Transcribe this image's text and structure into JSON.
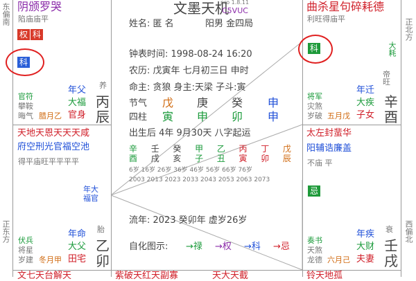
{
  "app": {
    "title": "文墨天机",
    "sub": "C5VUC",
    "ver": "pro 1.8.11"
  },
  "chart_main": {
    "name": "姓名: 匿 名",
    "gender": "阳男 金四局",
    "clock": "钟表时间: 1998-08-24 16:20",
    "lunar": "农历: 戊寅年 七月初三日 申时",
    "ming": "命主: 贪狼 身主:天梁 子斗:寅",
    "jieqi_label": "节气",
    "sizhu_label": "四柱",
    "jieqi": [
      "戊",
      "庚",
      "癸",
      "申"
    ],
    "sizhu": [
      "寅",
      "申",
      "卯",
      "申"
    ],
    "qiyun": "出生后 4年 9月30天 八字起运",
    "liunian": "流年: 2023 癸卯年 虚岁26岁",
    "zihua_label": "自化图示:",
    "zihua": [
      "→禄",
      "→权",
      "→科",
      "→忌"
    ],
    "dayun_stems": [
      "辛酉",
      "壬戌",
      "癸亥",
      "甲子",
      "乙丑",
      "丙寅",
      "丁卯",
      "戊辰"
    ],
    "dayun_ages": "6岁 16岁 26岁 36岁 46岁 56岁 66岁 76岁",
    "dayun_years": "2003 2013 2023 2033 2043 2053 2063 2073"
  },
  "cell_top_left": {
    "stars": "阴颁罗哭",
    "brightness": "陷庙庙平",
    "badge1": "权",
    "badge2": "科",
    "badge3": "科",
    "side": "东偏南"
  },
  "cell_mid_left": {
    "changsheng": "养",
    "shen1": "官符",
    "shen2": "攀鞍",
    "shen3": "晦气",
    "yun1": "年父",
    "yun2": "大福",
    "flow": "腊月乙",
    "palace": "官身",
    "ganzhi": "丙辰"
  },
  "cell_row2_left": {
    "stars_top": "天地天恩天天天咸",
    "stars_bot": "府空刑光官福空池",
    "brightness": "得平庙旺平平平平"
  },
  "cell_bottom_left": {
    "changsheng": "胎",
    "shen1": "伏兵",
    "shen2": "将星",
    "shen3": "岁建",
    "yun1": "年命",
    "yun2": "大父",
    "flow": "冬月甲",
    "palace": "田宅",
    "ganzhi": "乙卯",
    "side": "正东方"
  },
  "cell_top_right": {
    "stars": "曲杀星句碎耗德",
    "brightness": "利旺得庙平",
    "badge": "科",
    "side": "正北方"
  },
  "cell_mid_right": {
    "changsheng": "帝旺",
    "big": "大耗",
    "shen1": "将军",
    "shen2": "灾煞",
    "shen3": "岁破",
    "yun1": "年迁",
    "yun2": "大疾",
    "flow": "五月戊",
    "palace": "子女",
    "ganzhi": "辛酉"
  },
  "cell_row2_right": {
    "stars_top": "太左封蜚华",
    "stars_bot": "阳辅诰廉盖",
    "brightness": "不庙 平",
    "badge": "忌"
  },
  "cell_bottom_right": {
    "changsheng": "衰",
    "shen1": "奏书",
    "shen2": "天煞",
    "shen3": "龙德",
    "yun1": "年疾",
    "yun2": "大财",
    "flow": "六月己",
    "palace": "夫妻",
    "ganzhi": "壬戌",
    "side": "西偏北"
  },
  "left_mid_tag": {
    "a": "年大",
    "b": "福官"
  },
  "bottom_strip": {
    "left": "文七天台解天",
    "mid1": "紫破天红天副寡",
    "mid2": "天大天截",
    "right": "铃天地孤"
  },
  "colors": {
    "red": "#d0202a",
    "blue": "#1f4fd8",
    "green": "#1a9a3a",
    "badge_red": "#d83a2a",
    "badge_blue": "#2a5fd8",
    "badge_green": "#1e9a3a"
  }
}
